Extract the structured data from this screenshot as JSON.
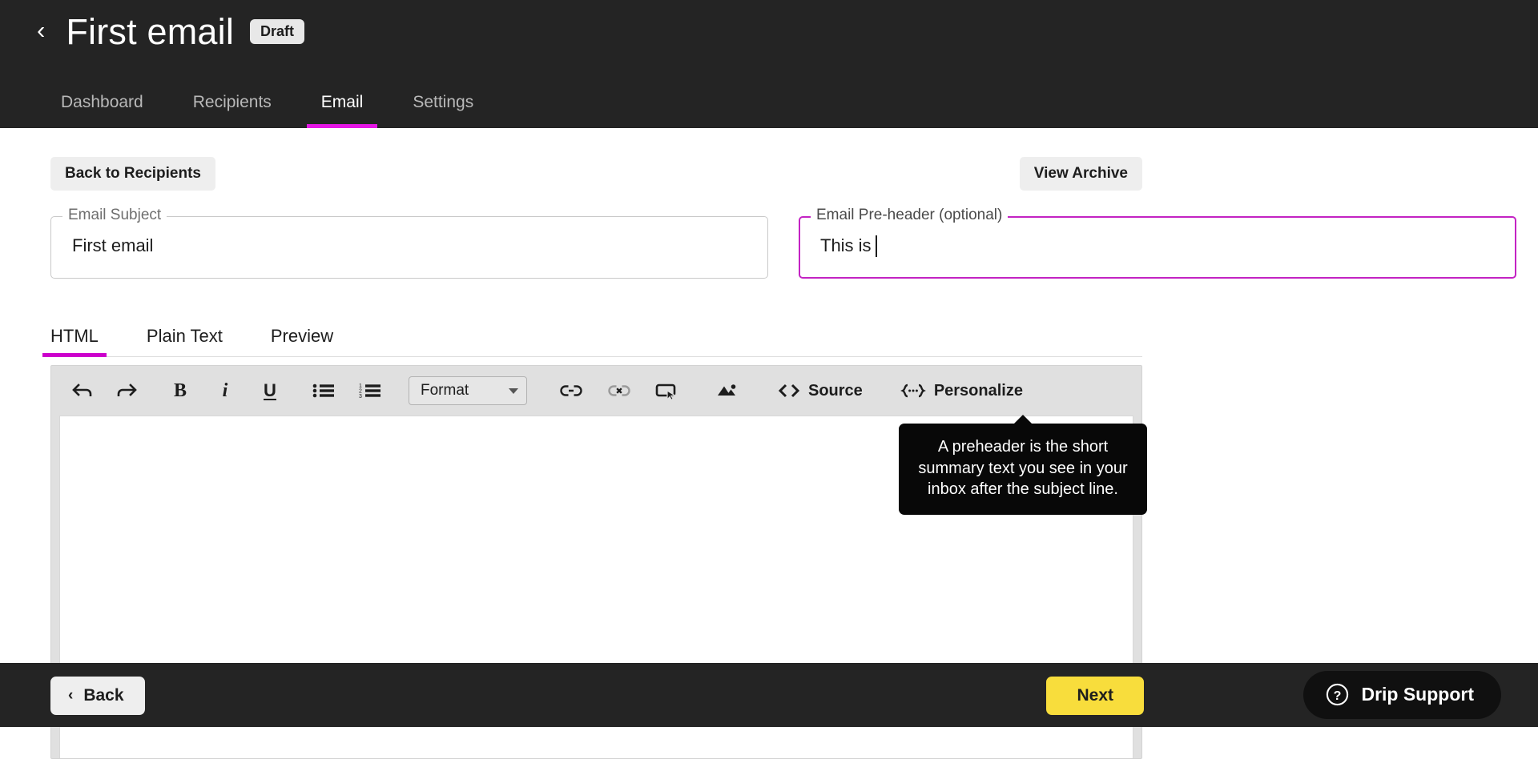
{
  "header": {
    "back_icon": "chevron-left-icon",
    "title": "First email",
    "status_badge": "Draft",
    "nav": [
      {
        "label": "Dashboard",
        "active": false
      },
      {
        "label": "Recipients",
        "active": false
      },
      {
        "label": "Email",
        "active": true
      },
      {
        "label": "Settings",
        "active": false
      }
    ]
  },
  "actions": {
    "back_to_recipients": "Back to Recipients",
    "view_archive": "View Archive"
  },
  "fields": {
    "subject": {
      "legend": "Email Subject",
      "value": "First email",
      "focused": false
    },
    "preheader": {
      "legend": "Email Pre-header (optional)",
      "value": "This is",
      "focused": true
    }
  },
  "tooltip": {
    "text": "A preheader is the short summary text you see in your inbox after the subject line."
  },
  "editor_tabs": [
    {
      "label": "HTML",
      "active": true
    },
    {
      "label": "Plain Text",
      "active": false
    },
    {
      "label": "Preview",
      "active": false
    }
  ],
  "toolbar": {
    "undo_icon": "undo-icon",
    "redo_icon": "redo-icon",
    "bold_label": "B",
    "italic_label": "i",
    "underline_label": "U",
    "bullet_list_icon": "bulleted-list-icon",
    "numbered_list_icon": "numbered-list-icon",
    "format_label": "Format",
    "link_icon": "link-icon",
    "unlink_icon": "unlink-icon",
    "button_icon": "insert-button-icon",
    "image_icon": "image-icon",
    "source_icon": "code-brackets-icon",
    "source_label": "Source",
    "personalize_icon": "merge-tag-icon",
    "personalize_label": "Personalize"
  },
  "editor_body": {
    "content": ""
  },
  "footer": {
    "back_icon": "chevron-left-icon",
    "back_label": "Back",
    "next_label": "Next",
    "support_icon": "question-circle-icon",
    "support_label": "Drip Support"
  },
  "colors": {
    "header_bg": "#242424",
    "accent_magenta": "#e516e5",
    "tab_underline": "#cc00cc",
    "field_focus": "#c323c3",
    "next_yellow": "#f8dd3c",
    "tooltip_bg": "#080808"
  }
}
